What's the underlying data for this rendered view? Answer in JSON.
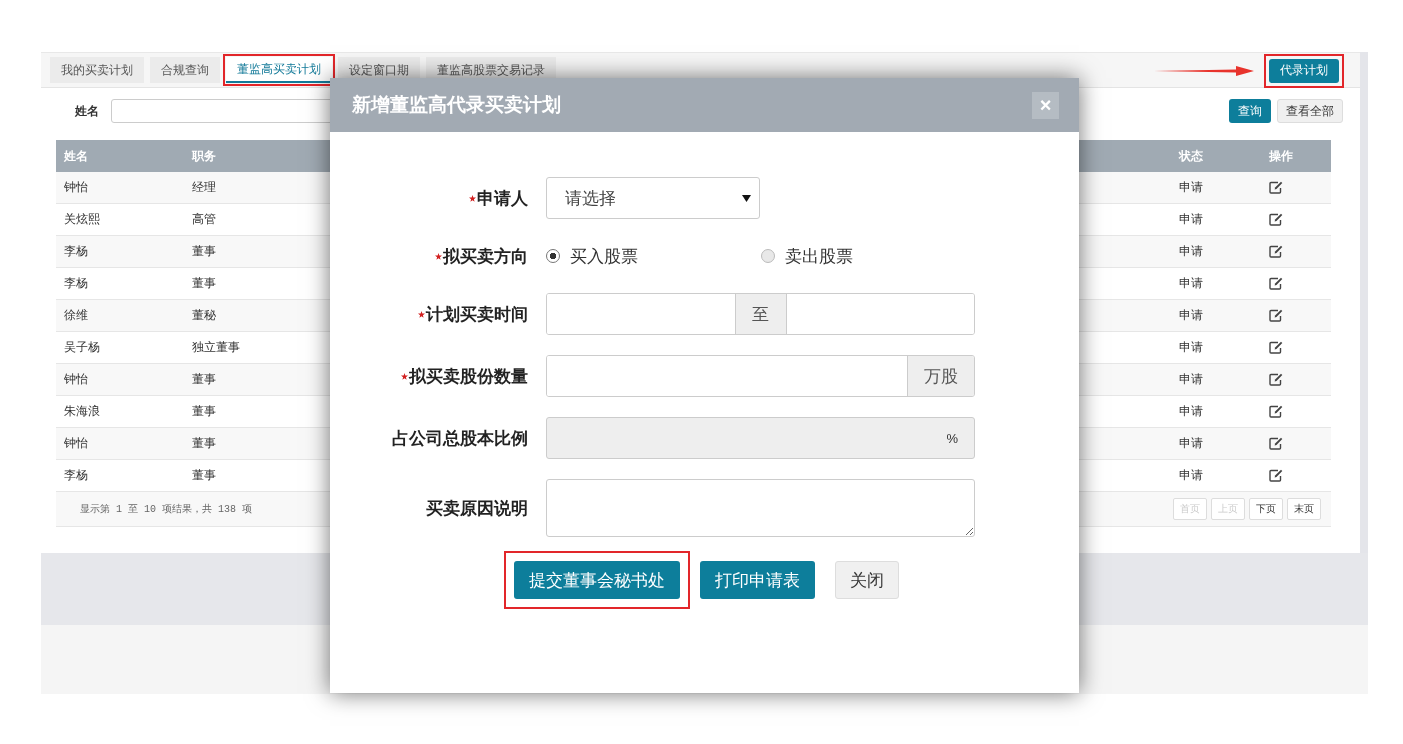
{
  "tabs": [
    {
      "label": "我的买卖计划",
      "selected": false,
      "highlighted": false
    },
    {
      "label": "合规查询",
      "selected": false,
      "highlighted": false
    },
    {
      "label": "董监高买卖计划",
      "selected": true,
      "highlighted": true
    },
    {
      "label": "设定窗口期",
      "selected": false,
      "highlighted": false
    },
    {
      "label": "董监高股票交易记录",
      "selected": false,
      "highlighted": false
    }
  ],
  "header_button": {
    "label": "代录计划",
    "highlighted": true,
    "arrow": true
  },
  "search": {
    "label": "姓名",
    "buttons": [
      {
        "label": "查询",
        "kind": "primary"
      },
      {
        "label": "查看全部",
        "kind": "default"
      }
    ]
  },
  "table": {
    "columns": [
      "姓名",
      "职务",
      "状态",
      "操作"
    ],
    "rows": [
      {
        "name": "钟怡",
        "position": "经理",
        "status": "申请"
      },
      {
        "name": "关炫熙",
        "position": "高管",
        "status": "申请"
      },
      {
        "name": "李杨",
        "position": "董事",
        "status": "申请"
      },
      {
        "name": "李杨",
        "position": "董事",
        "status": "申请"
      },
      {
        "name": "徐维",
        "position": "董秘",
        "status": "申请"
      },
      {
        "name": "吴子杨",
        "position": "独立董事",
        "status": "申请"
      },
      {
        "name": "钟怡",
        "position": "董事",
        "status": "申请"
      },
      {
        "name": "朱海浪",
        "position": "董事",
        "status": "申请"
      },
      {
        "name": "钟怡",
        "position": "董事",
        "status": "申请"
      },
      {
        "name": "李杨",
        "position": "董事",
        "status": "申请"
      }
    ]
  },
  "pagination": {
    "summary": "显示第 1 至 10 项结果，共 138 项",
    "pages": [
      {
        "label": "首页",
        "disabled": true
      },
      {
        "label": "上页",
        "disabled": true
      },
      {
        "label": "下页",
        "disabled": false
      },
      {
        "label": "末页",
        "disabled": false
      }
    ]
  },
  "dialog": {
    "title": "新增董监高代录买卖计划",
    "close": "×",
    "fields": [
      {
        "kind": "select",
        "label": "申请人",
        "required": true,
        "value": "请选择"
      },
      {
        "kind": "radio",
        "label": "拟买卖方向",
        "required": true,
        "options": [
          {
            "label": "买入股票",
            "selected": true
          },
          {
            "label": "卖出股票",
            "selected": false
          }
        ]
      },
      {
        "kind": "range",
        "label": "计划买卖时间",
        "required": true,
        "separator": "至"
      },
      {
        "kind": "addon",
        "label": "拟买卖股份数量",
        "required": true,
        "suffix": "万股"
      },
      {
        "kind": "readonly",
        "label": "占公司总股本比例",
        "required": false,
        "suffix": "%"
      },
      {
        "kind": "textarea",
        "label": "买卖原因说明",
        "required": false
      }
    ],
    "buttons": [
      {
        "label": "提交董事会秘书处",
        "kind": "primary",
        "highlighted": true
      },
      {
        "label": "打印申请表",
        "kind": "primary",
        "highlighted": false
      },
      {
        "label": "关闭",
        "kind": "default",
        "highlighted": false
      }
    ]
  }
}
